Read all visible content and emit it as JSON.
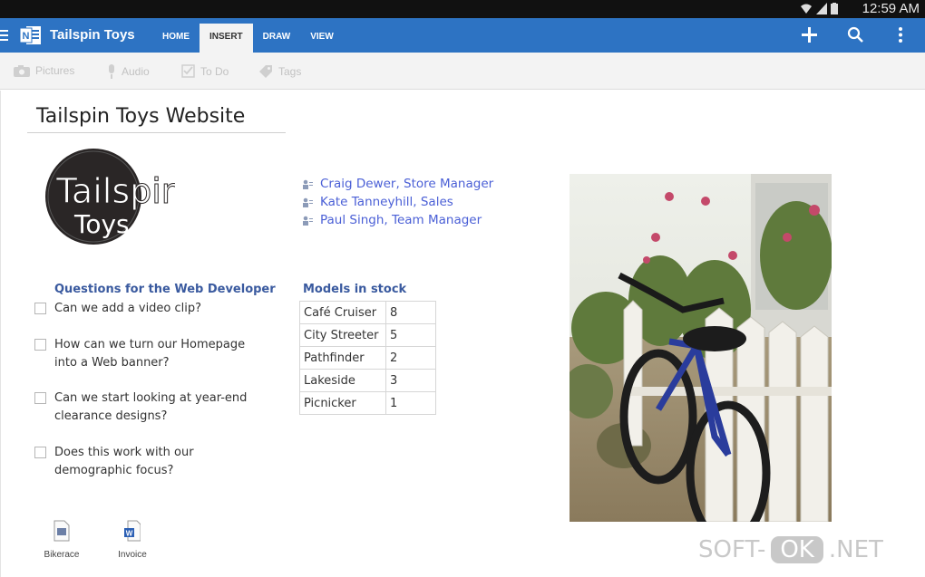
{
  "status_bar": {
    "time": "12:59 AM"
  },
  "app_bar": {
    "title": "Tailspin Toys",
    "tabs": [
      {
        "label": "HOME"
      },
      {
        "label": "INSERT"
      },
      {
        "label": "DRAW"
      },
      {
        "label": "VIEW"
      }
    ],
    "active_tab": "INSERT",
    "accent_color": "#2d73c3"
  },
  "ribbon": {
    "pictures": "Pictures",
    "audio": "Audio",
    "todo": "To Do",
    "tags": "Tags"
  },
  "page": {
    "title": "Tailspin Toys Website",
    "logo_text": {
      "line1": "Tailspin",
      "line2": "Toys"
    },
    "people": [
      {
        "name": "Craig Dewer, Store Manager"
      },
      {
        "name": "Kate Tanneyhill, Sales"
      },
      {
        "name": "Paul Singh, Team Manager"
      }
    ],
    "questions_heading": "Questions for the Web Developer",
    "questions": [
      {
        "text": "Can we add a video clip?"
      },
      {
        "text": "How can we turn our Homepage into a Web banner?"
      },
      {
        "text": "Can we start looking at year-end clearance designs?"
      },
      {
        "text": "Does this work with our demographic focus?"
      }
    ],
    "models_heading": "Models in stock",
    "models": [
      {
        "name": "Café Cruiser",
        "count": "8"
      },
      {
        "name": "City Streeter",
        "count": "5"
      },
      {
        "name": "Pathfinder",
        "count": "2"
      },
      {
        "name": "Lakeside",
        "count": "3"
      },
      {
        "name": "Picnicker",
        "count": "1"
      }
    ],
    "attachments": [
      {
        "label": "Bikerace"
      },
      {
        "label": "Invoice"
      }
    ]
  },
  "watermark": {
    "left": "SOFT-",
    "ok": "OK",
    "right": ".NET"
  }
}
